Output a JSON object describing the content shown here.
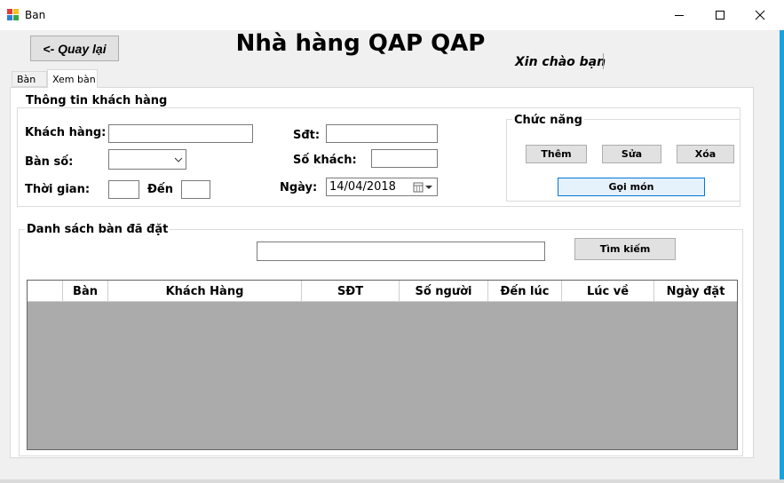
{
  "window": {
    "title": "Ban"
  },
  "header": {
    "back_label": "<- Quay lại",
    "title": "Nhà hàng QAP QAP",
    "greeting": "Xin chào bạn"
  },
  "tabs": [
    {
      "label": "Bàn"
    },
    {
      "label": "Xem bàn"
    }
  ],
  "customer_info": {
    "title": "Thông tin khách hàng",
    "customer_label": "Khách hàng:",
    "customer_value": "",
    "table_label": "Bàn số:",
    "table_value": "",
    "time_label": "Thời gian:",
    "time_from_value": "",
    "to_label": "Đến",
    "time_to_value": "",
    "phone_label": "Sđt:",
    "phone_value": "",
    "guests_label": "Số khách:",
    "guests_value": "",
    "date_label": "Ngày:",
    "date_value": "14/04/2018"
  },
  "functions": {
    "title": "Chức năng",
    "add_label": "Thêm",
    "edit_label": "Sửa",
    "delete_label": "Xóa",
    "order_label": "Gọi món"
  },
  "booking_list": {
    "title": "Danh sách bàn đã đặt",
    "search_value": "",
    "search_label": "Tìm kiếm",
    "columns": [
      "Bàn",
      "Khách Hàng",
      "SĐT",
      "Số người",
      "Đến lúc",
      "Lúc về",
      "Ngày đặt"
    ],
    "rows": []
  },
  "colors": {
    "accent_border": "#17a3de",
    "grid_background": "#ababab",
    "selected_button": "#e5f1fb",
    "selected_button_border": "#0078d7"
  }
}
